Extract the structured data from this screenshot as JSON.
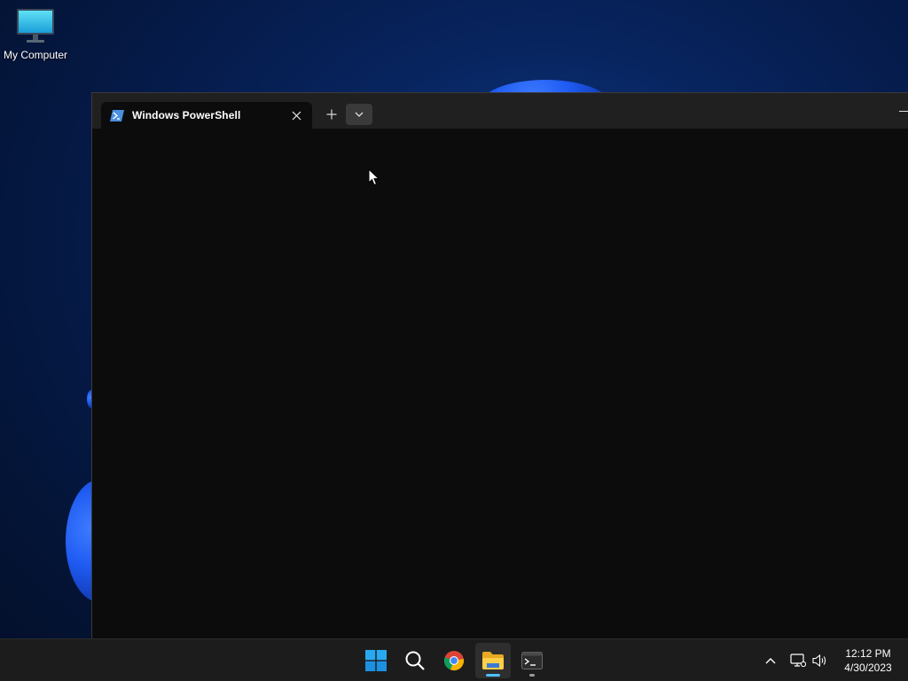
{
  "desktop": {
    "icons": [
      {
        "label": "My Computer",
        "icon": "monitor-icon"
      }
    ]
  },
  "terminal": {
    "tab": {
      "title": "Windows PowerShell",
      "icon": "powershell-icon"
    },
    "buttons": {
      "close_tab": "close-icon",
      "new_tab": "plus-icon",
      "dropdown": "chevron-down-icon",
      "minimize": "minimize-icon"
    },
    "background": "#0c0c0c",
    "titlebar_background": "#202020"
  },
  "taskbar": {
    "apps": [
      {
        "name": "Start",
        "icon": "windows-start-icon"
      },
      {
        "name": "Search",
        "icon": "search-icon"
      },
      {
        "name": "Google Chrome",
        "icon": "chrome-icon"
      },
      {
        "name": "File Explorer",
        "icon": "folder-icon",
        "active": true
      },
      {
        "name": "Terminal",
        "icon": "terminal-icon",
        "running": true
      }
    ],
    "tray": {
      "icons": [
        "chevron-up-icon",
        "network-icon",
        "volume-icon"
      ],
      "time": "12:12 PM",
      "date": "4/30/2023"
    },
    "accent": "#4cc2ff"
  }
}
